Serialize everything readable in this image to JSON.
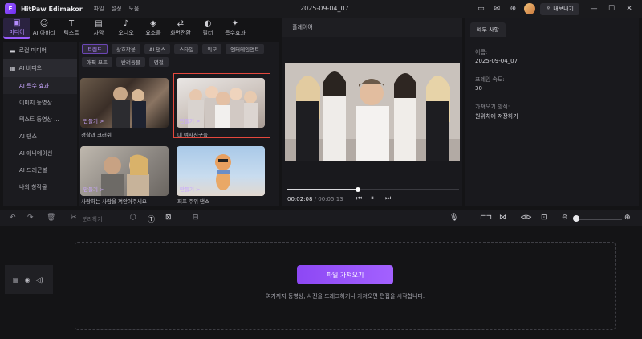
{
  "titlebar": {
    "app_name": "HitPaw Edimakor",
    "menu": [
      "파일",
      "설정",
      "도움"
    ],
    "project_title": "2025-09-04_07",
    "export_label": "내보내기"
  },
  "tabs": [
    {
      "label": "미디어",
      "icon": "media-icon",
      "glyph": "▣",
      "active": true
    },
    {
      "label": "AI 아바타",
      "icon": "ai-avatar-icon",
      "glyph": "☺",
      "active": false
    },
    {
      "label": "텍스트",
      "icon": "text-icon",
      "glyph": "T",
      "active": false
    },
    {
      "label": "자막",
      "icon": "subtitle-icon",
      "glyph": "▤",
      "active": false
    },
    {
      "label": "오디오",
      "icon": "audio-icon",
      "glyph": "♪",
      "active": false
    },
    {
      "label": "요소들",
      "icon": "elements-icon",
      "glyph": "◈",
      "active": false
    },
    {
      "label": "화면전환",
      "icon": "transition-icon",
      "glyph": "⇄",
      "active": false
    },
    {
      "label": "필터",
      "icon": "filter-icon",
      "glyph": "◐",
      "active": false
    },
    {
      "label": "특수효과",
      "icon": "effects-icon",
      "glyph": "✦",
      "active": false
    }
  ],
  "sidebar": {
    "local_media": "로컬 미디어",
    "ai_video": "AI 비디오",
    "subitems": [
      "AI 특수 효과",
      "이미지 동영상 ...",
      "텍스트 동영상 ...",
      "AI 댄스",
      "AI 애니메이션",
      "AI 드래곤볼",
      "나의 창작물"
    ],
    "active_sub": 0
  },
  "filters": [
    {
      "label": "트렌드",
      "active": true
    },
    {
      "label": "상호작용",
      "active": false
    },
    {
      "label": "AI 댄스",
      "active": false
    },
    {
      "label": "스타일",
      "active": false
    },
    {
      "label": "외모",
      "active": false
    },
    {
      "label": "엔터테인먼트",
      "active": false
    },
    {
      "label": "애픽 모프",
      "active": false
    },
    {
      "label": "반려동물",
      "active": false
    },
    {
      "label": "명절",
      "active": false
    }
  ],
  "cards": [
    {
      "label": "경찰과 크러쉬",
      "cta": "만들기 >"
    },
    {
      "label": "내 여자친구들",
      "cta": "만들기 >"
    },
    {
      "label": "사랑하는 사람을 껴안아주세요",
      "cta": "만들기 >"
    },
    {
      "label": "퍼프 주위 댄스",
      "cta": "만들기 >"
    }
  ],
  "player": {
    "title": "플레이어",
    "current_time": "00:02:08",
    "duration": "/ 00:05:13",
    "progress": 0.41
  },
  "props": {
    "tab": "세부 사항",
    "name_label": "이름:",
    "name_value": "2025-09-04_07",
    "fps_label": "프레임 속도:",
    "fps_value": "30",
    "import_label": "가져오기 방식:",
    "import_value": "원위치에 저장하기"
  },
  "timeline": {
    "split_label": "분리하기",
    "import_button": "파일 가져오기",
    "hint": "여기까지 동영상, 사진을 드래그하거나 가져오면 편집을 시작합니다."
  },
  "colors": {
    "accent": "#9b5cff",
    "selection": "#e5483d"
  }
}
